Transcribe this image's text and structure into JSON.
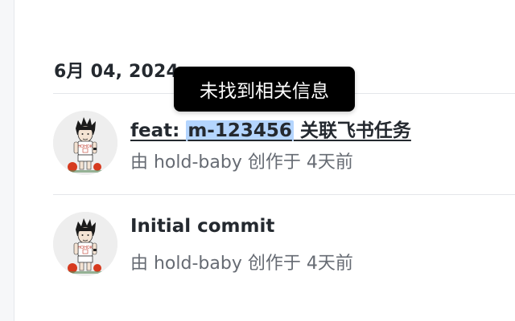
{
  "date_group": "6月 04, 2024",
  "commits": [
    {
      "title_prefix": "feat: ",
      "ref": "m-123456",
      "title_suffix": " 关联飞书任务",
      "meta": "由 hold-baby 创作于 4天前"
    },
    {
      "title": "Initial commit",
      "meta": "由 hold-baby 创作于 4天前"
    }
  ],
  "tooltip": "未找到相关信息",
  "colors": {
    "ref_highlight": "#b4d5fe",
    "tooltip_bg": "#000000",
    "meta_text": "#666b73"
  },
  "icons": {
    "avatar": "cartoon-basketball-player-avatar"
  }
}
